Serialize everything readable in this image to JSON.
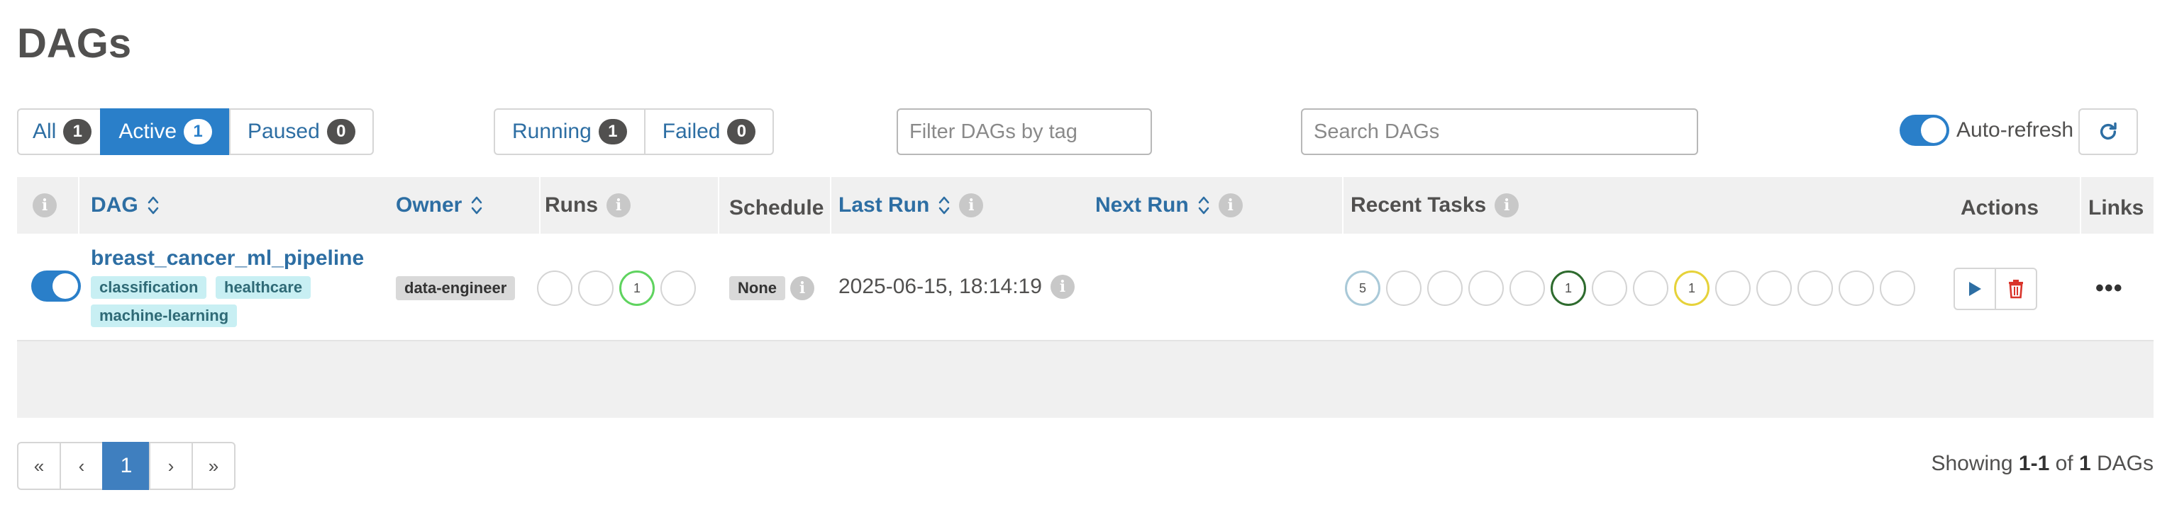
{
  "page": {
    "title": "DAGs"
  },
  "status_filter": [
    {
      "label": "All",
      "count": "1"
    },
    {
      "label": "Active",
      "count": "1"
    },
    {
      "label": "Paused",
      "count": "0"
    }
  ],
  "run_filter": [
    {
      "label": "Running",
      "count": "1"
    },
    {
      "label": "Failed",
      "count": "0"
    }
  ],
  "tag_filter": {
    "placeholder": "Filter DAGs by tag"
  },
  "search": {
    "placeholder": "Search DAGs"
  },
  "auto_refresh": {
    "label": "Auto-refresh",
    "enabled": true
  },
  "table": {
    "headers": {
      "dag": "DAG",
      "owner": "Owner",
      "runs": "Runs",
      "schedule": "Schedule",
      "last_run": "Last Run",
      "next_run": "Next Run",
      "recent_tasks": "Recent Tasks",
      "actions": "Actions",
      "links": "Links"
    },
    "rows": [
      {
        "dag_id": "breast_cancer_ml_pipeline",
        "active": true,
        "tags": [
          "classification",
          "healthcare",
          "machine-learning"
        ],
        "owner": "data-engineer",
        "runs": [
          {
            "count": "",
            "color": "#d4d4d4"
          },
          {
            "count": "",
            "color": "#d4d4d4"
          },
          {
            "count": "1",
            "color": "#5fd35f"
          },
          {
            "count": "",
            "color": "#d4d4d4"
          }
        ],
        "schedule": "None",
        "last_run": "2025-06-15, 18:14:19",
        "next_run": "",
        "recent_tasks": [
          {
            "count": "5",
            "color": "#a9c9d8"
          },
          {
            "count": "",
            "color": "#d4d4d4"
          },
          {
            "count": "",
            "color": "#d4d4d4"
          },
          {
            "count": "",
            "color": "#d4d4d4"
          },
          {
            "count": "",
            "color": "#d4d4d4"
          },
          {
            "count": "1",
            "color": "#2e6b2e"
          },
          {
            "count": "",
            "color": "#d4d4d4"
          },
          {
            "count": "",
            "color": "#d4d4d4"
          },
          {
            "count": "1",
            "color": "#e6d23a"
          },
          {
            "count": "",
            "color": "#d4d4d4"
          },
          {
            "count": "",
            "color": "#d4d4d4"
          },
          {
            "count": "",
            "color": "#d4d4d4"
          },
          {
            "count": "",
            "color": "#d4d4d4"
          },
          {
            "count": "",
            "color": "#d4d4d4"
          }
        ],
        "links_label": "•••"
      }
    ]
  },
  "pagination": {
    "first": "«",
    "prev": "‹",
    "current": "1",
    "next": "›",
    "last": "»"
  },
  "footer": {
    "showing_prefix": "Showing ",
    "range": "1-1",
    "of_word": " of ",
    "total": "1",
    "suffix": " DAGs"
  },
  "colors": {
    "accent": "#2a7fc9",
    "link": "#2d6ea3",
    "tag_bg": "#c8eff3",
    "delete": "#d9342b"
  }
}
